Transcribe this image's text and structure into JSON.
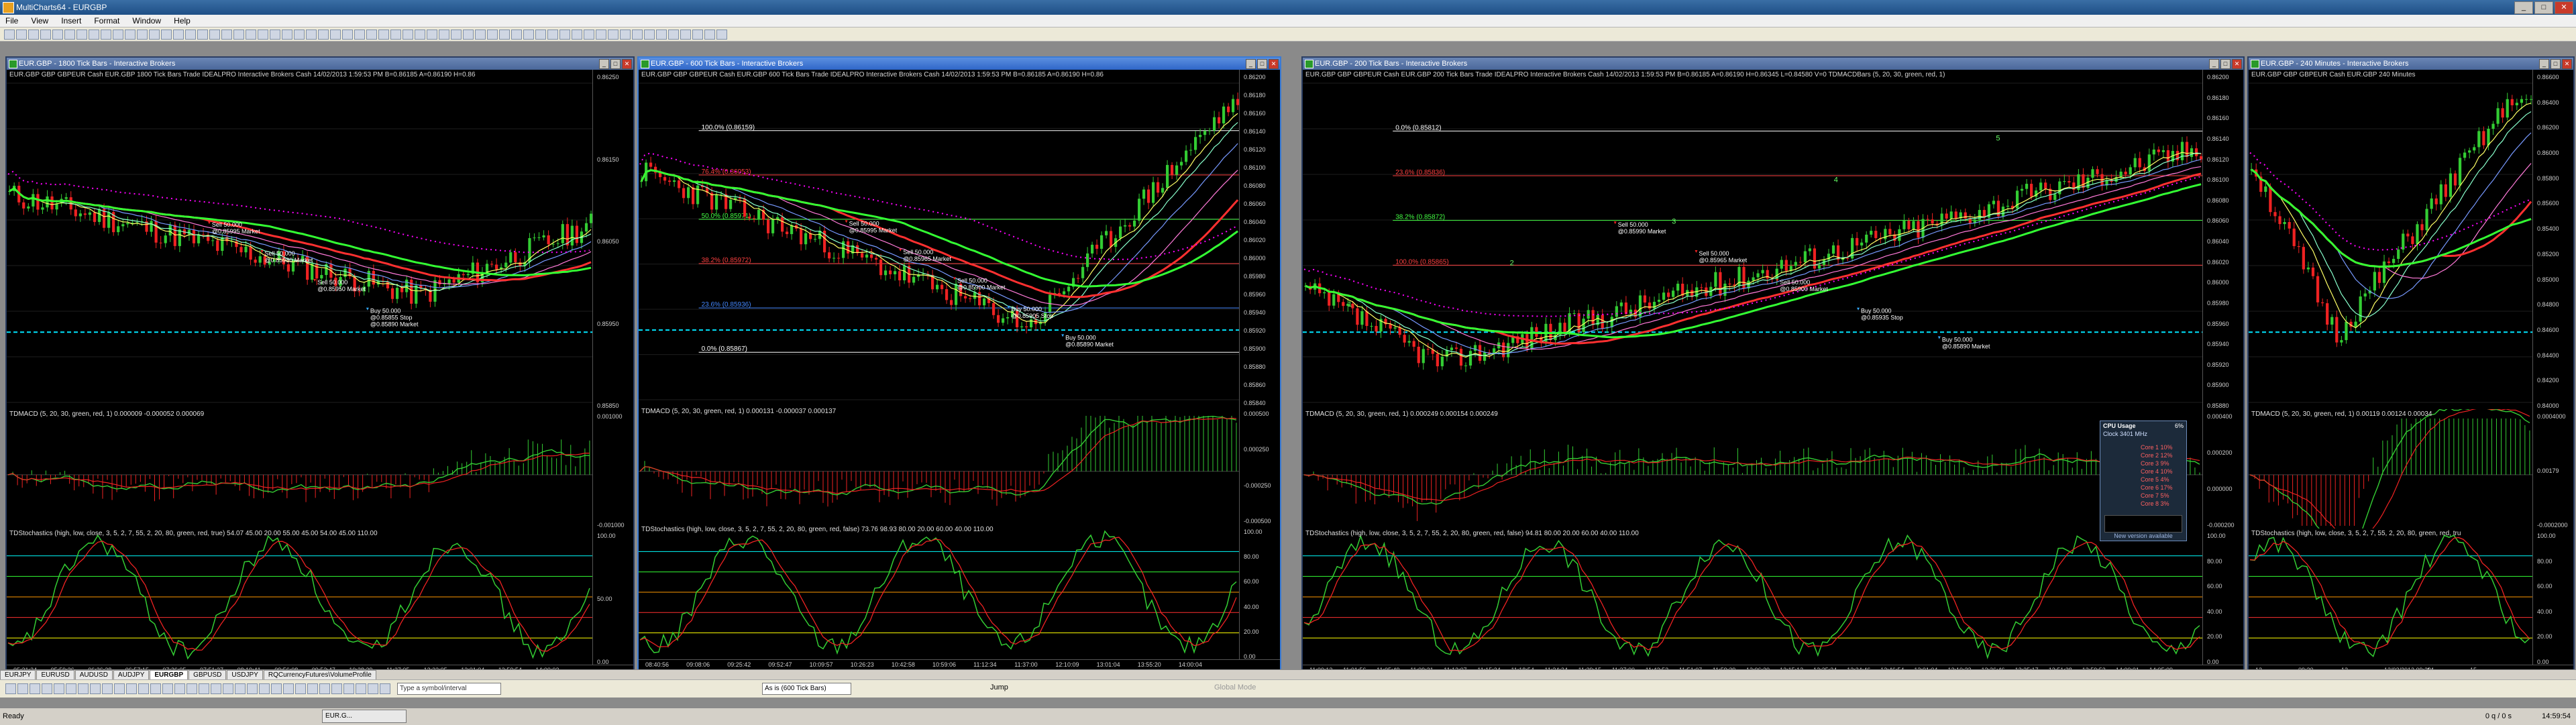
{
  "app": {
    "title": "MultiCharts64 - EURGBP"
  },
  "menu": [
    "File",
    "View",
    "Insert",
    "Format",
    "Window",
    "Help"
  ],
  "charts": [
    {
      "id": "c1",
      "title": "EUR.GBP - 1800 Tick Bars - Interactive Brokers",
      "info": "EUR.GBP  GBP GBPEUR Cash EUR.GBP  1800 Tick Bars  Trade  IDEALPRO  Interactive Brokers  Cash  14/02/2013  1:59:53 PM  B=0.86185  A=0.86190  H=0.86",
      "price_ticks": [
        "0.86250",
        "0.86150",
        "0.86050",
        "0.85950",
        "0.85850"
      ],
      "price_tags": [
        "0.86190",
        "0.86185",
        "0.86125"
      ],
      "macd_legend": "TDMACD (5, 20, 30, green, red, 1)  0.000009  -0.000052  0.000069",
      "macd_ticks": [
        "0.001000",
        "-0.001000"
      ],
      "stoch_legend": "TDStochastics (high, low, close, 3, 5, 2, 7, 55, 2, 20, 80, green, red, true)  54.07  45.00  20.00  55.00  45.00  54.00  45.00  110.00",
      "stoch_ticks": [
        "100.00",
        "50.00",
        "0.00"
      ],
      "time_ticks": [
        "05:31:24",
        "05:59:36",
        "06:36:28",
        "06:57:15",
        "07:26:05",
        "07:51:27",
        "08:19:41",
        "09:56:08",
        "09:52:47",
        "10:28:29",
        "11:37:05",
        "12:33:05",
        "13:01:04",
        "13:59:54",
        "14:00:02"
      ],
      "annotations": [
        {
          "text": "Sell 50.000\n@0.85995 Market",
          "color": "#ffffff"
        },
        {
          "text": "Sell 50.000\n@0.85980 Market",
          "color": "#ffffff"
        },
        {
          "text": "Sell 50.000\n@0.85950 Market",
          "color": "#ffffff"
        },
        {
          "text": "Buy 50.000\n@0.85855 Stop\n@0.85890 Market",
          "color": "#ffffff"
        }
      ]
    },
    {
      "id": "c2",
      "title": "EUR.GBP - 600 Tick Bars - Interactive Brokers",
      "info": "EUR.GBP  GBP GBPEUR Cash EUR.GBP  600 Tick Bars  Trade  IDEALPRO  Interactive Brokers  Cash  14/02/2013  1:59:53 PM  B=0.86185  A=0.86190  H=0.86",
      "price_ticks": [
        "0.86200",
        "0.86180",
        "0.86160",
        "0.86140",
        "0.86120",
        "0.86100",
        "0.86080",
        "0.86060",
        "0.86040",
        "0.86020",
        "0.86000",
        "0.85980",
        "0.85960",
        "0.85940",
        "0.85920",
        "0.85900",
        "0.85880",
        "0.85860",
        "0.85840"
      ],
      "fib_labels": [
        "100.0% (0.86159)",
        "76.4% (0.86053)",
        "50.0% (0.85971)",
        "38.2% (0.85972)",
        "23.6% (0.85936)",
        "0.0% (0.85867)"
      ],
      "macd_legend": "TDMACD (5, 20, 30, green, red, 1)  0.000131  -0.000037  0.000137",
      "macd_ticks": [
        "0.000500",
        "0.000250",
        "-0.000250",
        "-0.000500"
      ],
      "stoch_legend": "TDStochastics (high, low, close, 3, 5, 2, 7, 55, 2, 20, 80, green, red, false)  73.76  98.93  80.00  20.00  60.00  40.00  110.00",
      "stoch_ticks": [
        "100.00",
        "80.00",
        "60.00",
        "40.00",
        "20.00",
        "0.00"
      ],
      "time_ticks": [
        "08:40:56",
        "09:08:06",
        "09:25:42",
        "09:52:47",
        "10:09:57",
        "10:26:23",
        "10:42:58",
        "10:59:06",
        "11:12:34",
        "11:37:00",
        "12:10:09",
        "13:01:04",
        "13:55:20",
        "14:00:04"
      ],
      "annotations": [
        {
          "text": "Sell 50.000\n@0.85995 Market",
          "color": "#ffffff"
        },
        {
          "text": "Sell 50.000\n@0.85965 Market",
          "color": "#ffffff"
        },
        {
          "text": "Sell 50.000\n@0.85900 Market",
          "color": "#ffffff"
        },
        {
          "text": "Buy 50.000\n@0.85905 Stop",
          "color": "#ffffff"
        },
        {
          "text": "Buy 50.000\n@0.85890 Market",
          "color": "#ffffff"
        }
      ]
    },
    {
      "id": "c3",
      "title": "EUR.GBP - 200 Tick Bars - Interactive Brokers",
      "info": "EUR.GBP  GBP GBPEUR Cash EUR.GBP  200 Tick Bars  Trade  IDEALPRO  Interactive Brokers  Cash  14/02/2013  1:59:53 PM  B=0.86185  A=0.86190  H=0.86345  L=0.84580  V=0  TDMACDBars (5, 20, 30, green, red, 1)",
      "price_ticks": [
        "0.86200",
        "0.86180",
        "0.86160",
        "0.86140",
        "0.86120",
        "0.86100",
        "0.86080",
        "0.86060",
        "0.86040",
        "0.86020",
        "0.86000",
        "0.85980",
        "0.85960",
        "0.85940",
        "0.85920",
        "0.85900",
        "0.85880"
      ],
      "fib_labels": [
        "0.0% (0.85812)",
        "23.6% (0.85836)",
        "38.2% (0.85872)",
        "100.0% (0.85865)"
      ],
      "macd_legend": "TDMACD (5, 20, 30, green, red, 1)  0.000249  0.000154  0.000249",
      "macd_ticks": [
        "0.000400",
        "0.000200",
        "0.000000",
        "-0.000200"
      ],
      "stoch_legend": "TDStochastics (high, low, close, 3, 5, 2, 7, 55, 2, 20, 80, green, red, false)  94.81  80.00  20.00  60.00  40.00  110.00",
      "stoch_ticks": [
        "100.00",
        "80.00",
        "60.00",
        "40.00",
        "20.00",
        "0.00"
      ],
      "time_ticks": [
        "11:00:13",
        "11:01:56",
        "11:05:49",
        "11:09:21",
        "11:13:07",
        "11:15:24",
        "11:18:54",
        "11:24:24",
        "11:29:15",
        "11:37:00",
        "11:42:52",
        "11:51:07",
        "11:59:39",
        "12:06:30",
        "12:15:13",
        "12:25:34",
        "12:34:46",
        "12:46:54",
        "13:01:04",
        "13:10:23",
        "13:26:46",
        "13:35:17",
        "13:51:38",
        "13:59:53",
        "14:00:01",
        "14:05:09"
      ],
      "annotations": [
        {
          "text": "Sell 50.000\n@0.85990 Market",
          "color": "#ffffff"
        },
        {
          "text": "Sell 50.000\n@0.85965 Market",
          "color": "#ffffff"
        },
        {
          "text": "Sell 50.000\n@0.85900 Market",
          "color": "#ffffff"
        },
        {
          "text": "Buy 50.000\n@0.85935 Stop",
          "color": "#ffffff"
        },
        {
          "text": "Buy 50.000\n@0.85890 Market",
          "color": "#ffffff"
        }
      ],
      "wave_counts": [
        "1",
        "2",
        "3",
        "4",
        "5"
      ]
    },
    {
      "id": "c4",
      "title": "EUR.GBP - 240 Minutes - Interactive Brokers",
      "info": "EUR.GBP  GBP GBPEUR Cash EUR.GBP  240 Minutes",
      "price_ticks": [
        "0.86600",
        "0.86400",
        "0.86200",
        "0.86000",
        "0.85800",
        "0.85600",
        "0.85400",
        "0.85200",
        "0.85000",
        "0.84800",
        "0.84600",
        "0.84400",
        "0.84200",
        "0.84000"
      ],
      "macd_legend": "TDMACD (5, 20, 30, green, red, 1)  0.00119  0.00124  0.00034",
      "macd_ticks": [
        "0.0004000",
        "0.00179",
        "-0.0002000"
      ],
      "stoch_legend": "TDStochastics (high, low, close, 3, 5, 2, 7, 55, 2, 20, 80, green, red, tru",
      "stoch_ticks": [
        "100.00",
        "80.00",
        "60.00",
        "40.00",
        "20.00",
        "0.00"
      ],
      "time_ticks": [
        "13",
        "09:30",
        "12",
        "13/02/2013  09:30",
        "14",
        "15"
      ],
      "annotations": []
    }
  ],
  "cpu": {
    "title": "CPU Usage",
    "pct": "6%",
    "clock": "Clock 3401 MHz",
    "cores": [
      "Core 1  10%",
      "Core 2  12%",
      "Core 3  9%",
      "Core 4  10%",
      "Core 5  4%",
      "Core 6  17%",
      "Core 7  5%",
      "Core 8  3%"
    ],
    "footer": "New version available"
  },
  "instrument_tabs": [
    "EURJPY",
    "EURUSD",
    "AUDUSD",
    "AUDJPY",
    "EURGBP",
    "GBPUSD",
    "USDJPY",
    "RQCurrencyFutures\\VolumeProfile"
  ],
  "active_tab": "EURGBP",
  "bottom": {
    "symbol_placeholder": "Type a symbol/interval",
    "resolution": "As is (600 Tick Bars)",
    "jump": "Jump",
    "global_mode": "Global Mode"
  },
  "status": {
    "ready": "Ready",
    "task": "EUR.G...",
    "counts": "0 q / 0 s",
    "clock": "14:59:54"
  },
  "colors": {
    "bull": "#33cc33",
    "bear": "#ee2222",
    "ma_red": "#ff3030",
    "ma_green": "#33ff33",
    "ma_magenta": "#ff00ff",
    "cyan_dash": "#00e5ff",
    "active_border": "#3a7bd5"
  }
}
